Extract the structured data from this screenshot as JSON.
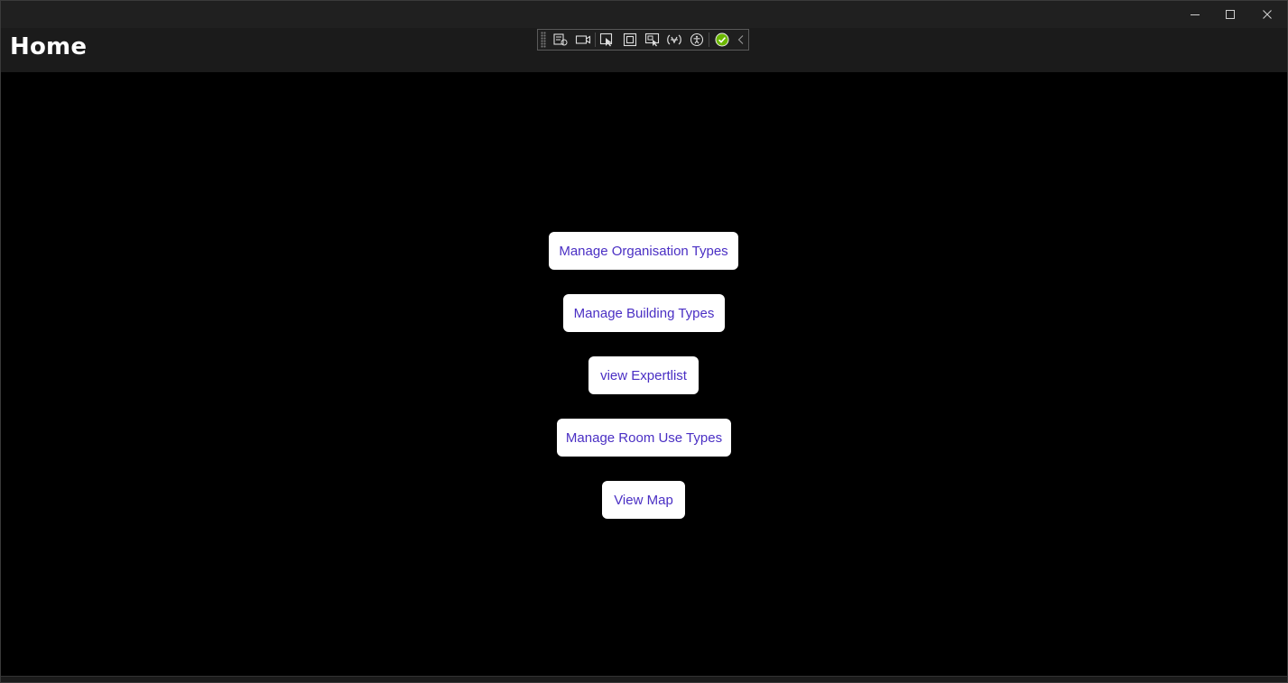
{
  "window": {
    "controls": {
      "minimize_icon": "minimize-icon",
      "maximize_icon": "maximize-icon",
      "close_icon": "close-icon"
    }
  },
  "header": {
    "title": "Home"
  },
  "debug_toolbar": {
    "items": [
      "live-visual-tree-icon",
      "record-icon",
      "select-element-icon",
      "display-layout-adorners-icon",
      "track-focused-element-icon",
      "binding-failures-icon",
      "accessibility-icon",
      "check-icon",
      "collapse-chevron-icon"
    ],
    "status_color": "#6bb700"
  },
  "main": {
    "buttons": [
      {
        "label": "Manage Organisation Types"
      },
      {
        "label": "Manage Building Types"
      },
      {
        "label": "view Expertlist"
      },
      {
        "label": "Manage Room Use Types"
      },
      {
        "label": "View Map"
      }
    ]
  },
  "colors": {
    "background": "#000000",
    "header": "#1b1b1b",
    "titlebar": "#202020",
    "button_bg": "#ffffff",
    "button_text": "#4a2fc4"
  }
}
